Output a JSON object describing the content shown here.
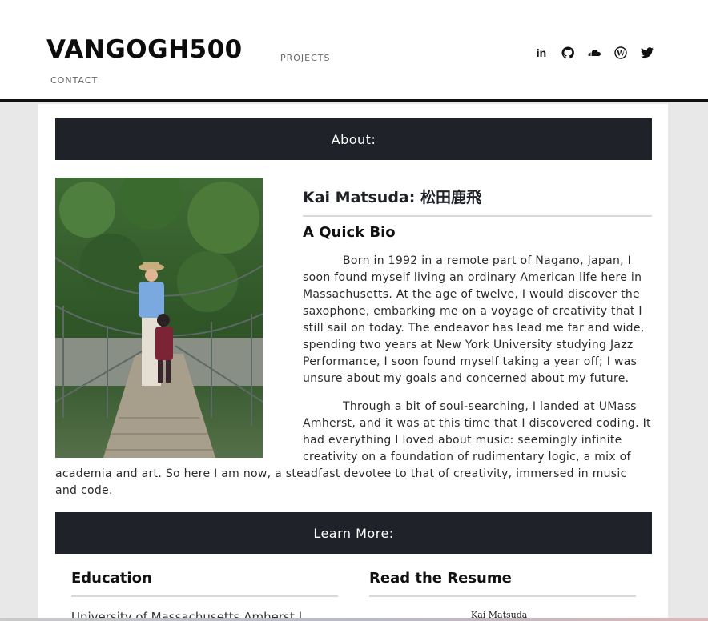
{
  "header": {
    "logo": "VANGOGH500",
    "nav": {
      "projects": "PROJECTS",
      "contact": "CONTACT"
    },
    "social": [
      {
        "name": "linkedin-icon",
        "glyph": "in"
      },
      {
        "name": "github-icon",
        "glyph": "●"
      },
      {
        "name": "soundcloud-icon",
        "glyph": "☁"
      },
      {
        "name": "wordpress-icon",
        "glyph": "W"
      },
      {
        "name": "twitter-icon",
        "glyph": "🐦"
      }
    ]
  },
  "about": {
    "band_title": "About:",
    "name": "Kai Matsuda: 松田鹿飛",
    "subhead": "A Quick Bio",
    "bio_p1": "Born in 1992 in a remote part of Nagano, Japan, I soon found myself living an ordinary American life here in Massachusetts. At the age of twelve, I would discover the saxophone, embarking me on a voyage of creativity that I still sail on today. The endeavor has lead me far and wide, spending two years at New York University studying Jazz Performance, I soon found myself taking a year off; I was unsure about my goals and concerned about my future.",
    "bio_p2_part1": "Through a bit of soul-searching, I landed at UMass Amherst, and it was at this time that I discovered coding. It had everything I loved about music: seemingly infinite creativity on a foundation of rudimentary logic, a mix of",
    "bio_p2_part2": "academia and art. So here I am now, a steadfast devotee to that of creativity, immersed in music and code."
  },
  "learn": {
    "band_title": "Learn More:",
    "education_title": "Education",
    "education_item": "University of Massachusetts Amherst |",
    "resume_title": "Read the Resume",
    "resume_thumb": "Kai Matsuda"
  }
}
